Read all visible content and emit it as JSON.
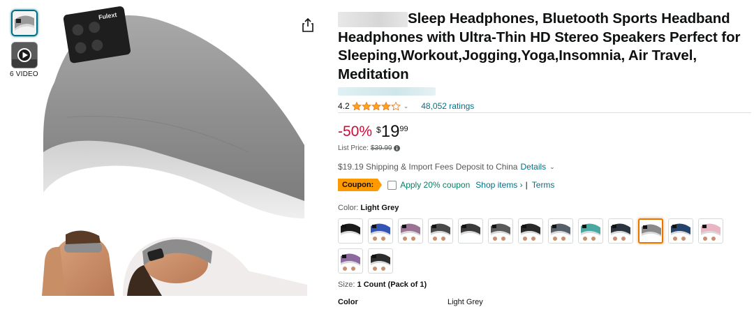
{
  "gallery": {
    "video_count_label": "6 VIDEO",
    "thumb_icons": [
      "headband-thumbnail",
      "video-play-icon"
    ],
    "main_image_logo_text": "Fulext"
  },
  "product": {
    "title": "Sleep Headphones, Bluetooth Sports Headband Headphones with Ultra-Thin HD Stereo Speakers Perfect for Sleeping,Workout,Jogging,Yoga,Insomnia, Air Travel, Meditation",
    "rating_value": "4.2",
    "rating_stars": 4.2,
    "ratings_count": "48,052 ratings"
  },
  "price": {
    "discount": "-50%",
    "currency": "$",
    "whole": "19",
    "fraction": "99",
    "list_price_label": "List Price:",
    "list_price_value": "$39.99"
  },
  "shipping": {
    "text": "$19.19 Shipping & Import Fees Deposit to China",
    "details_link": "Details"
  },
  "coupon": {
    "badge": "Coupon:",
    "apply_label": "Apply 20% coupon",
    "shop_items": "Shop items ›",
    "separator": "|",
    "terms": "Terms"
  },
  "color": {
    "label": "Color:",
    "selected": "Light Grey",
    "swatches": [
      {
        "name": "black",
        "color": "#1b1b1b"
      },
      {
        "name": "blue",
        "color": "#3355b5"
      },
      {
        "name": "purple",
        "color": "#9b7394"
      },
      {
        "name": "dark grey",
        "color": "#4a4a4a"
      },
      {
        "name": "charcoal",
        "color": "#3b3b3b"
      },
      {
        "name": "grey",
        "color": "#5a5a5a"
      },
      {
        "name": "black pattern",
        "color": "#2a2a2a"
      },
      {
        "name": "slate",
        "color": "#55606a"
      },
      {
        "name": "teal",
        "color": "#4aa8a3"
      },
      {
        "name": "navy",
        "color": "#2c3440"
      },
      {
        "name": "light grey",
        "color": "#8a8a8a"
      },
      {
        "name": "dark blue",
        "color": "#24446e"
      },
      {
        "name": "pink",
        "color": "#eab5c3"
      },
      {
        "name": "lavender",
        "color": "#8e6b9e"
      },
      {
        "name": "black grey",
        "color": "#2e2e2e"
      }
    ],
    "selected_index": 10
  },
  "size": {
    "label": "Size:",
    "value": "1 Count (Pack of 1)"
  },
  "details": {
    "color_key": "Color",
    "color_value": "Light Grey"
  },
  "colors": {
    "link": "#007185",
    "discount": "#cc0c39",
    "coupon_badge": "#fe9900",
    "coupon_text": "#067d62",
    "star": "#ffa41c",
    "selected_border": "#e77600"
  }
}
